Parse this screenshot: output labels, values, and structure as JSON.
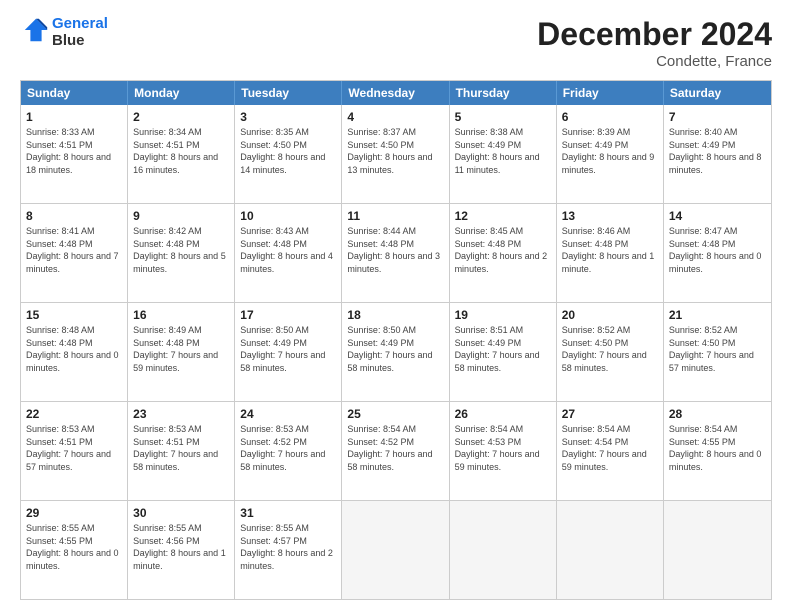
{
  "header": {
    "logo_line1": "General",
    "logo_line2": "Blue",
    "title": "December 2024",
    "subtitle": "Condette, France"
  },
  "days_of_week": [
    "Sunday",
    "Monday",
    "Tuesday",
    "Wednesday",
    "Thursday",
    "Friday",
    "Saturday"
  ],
  "weeks": [
    [
      {
        "day": "1",
        "text": "Sunrise: 8:33 AM\nSunset: 4:51 PM\nDaylight: 8 hours and 18 minutes."
      },
      {
        "day": "2",
        "text": "Sunrise: 8:34 AM\nSunset: 4:51 PM\nDaylight: 8 hours and 16 minutes."
      },
      {
        "day": "3",
        "text": "Sunrise: 8:35 AM\nSunset: 4:50 PM\nDaylight: 8 hours and 14 minutes."
      },
      {
        "day": "4",
        "text": "Sunrise: 8:37 AM\nSunset: 4:50 PM\nDaylight: 8 hours and 13 minutes."
      },
      {
        "day": "5",
        "text": "Sunrise: 8:38 AM\nSunset: 4:49 PM\nDaylight: 8 hours and 11 minutes."
      },
      {
        "day": "6",
        "text": "Sunrise: 8:39 AM\nSunset: 4:49 PM\nDaylight: 8 hours and 9 minutes."
      },
      {
        "day": "7",
        "text": "Sunrise: 8:40 AM\nSunset: 4:49 PM\nDaylight: 8 hours and 8 minutes."
      }
    ],
    [
      {
        "day": "8",
        "text": "Sunrise: 8:41 AM\nSunset: 4:48 PM\nDaylight: 8 hours and 7 minutes."
      },
      {
        "day": "9",
        "text": "Sunrise: 8:42 AM\nSunset: 4:48 PM\nDaylight: 8 hours and 5 minutes."
      },
      {
        "day": "10",
        "text": "Sunrise: 8:43 AM\nSunset: 4:48 PM\nDaylight: 8 hours and 4 minutes."
      },
      {
        "day": "11",
        "text": "Sunrise: 8:44 AM\nSunset: 4:48 PM\nDaylight: 8 hours and 3 minutes."
      },
      {
        "day": "12",
        "text": "Sunrise: 8:45 AM\nSunset: 4:48 PM\nDaylight: 8 hours and 2 minutes."
      },
      {
        "day": "13",
        "text": "Sunrise: 8:46 AM\nSunset: 4:48 PM\nDaylight: 8 hours and 1 minute."
      },
      {
        "day": "14",
        "text": "Sunrise: 8:47 AM\nSunset: 4:48 PM\nDaylight: 8 hours and 0 minutes."
      }
    ],
    [
      {
        "day": "15",
        "text": "Sunrise: 8:48 AM\nSunset: 4:48 PM\nDaylight: 8 hours and 0 minutes."
      },
      {
        "day": "16",
        "text": "Sunrise: 8:49 AM\nSunset: 4:48 PM\nDaylight: 7 hours and 59 minutes."
      },
      {
        "day": "17",
        "text": "Sunrise: 8:50 AM\nSunset: 4:49 PM\nDaylight: 7 hours and 58 minutes."
      },
      {
        "day": "18",
        "text": "Sunrise: 8:50 AM\nSunset: 4:49 PM\nDaylight: 7 hours and 58 minutes."
      },
      {
        "day": "19",
        "text": "Sunrise: 8:51 AM\nSunset: 4:49 PM\nDaylight: 7 hours and 58 minutes."
      },
      {
        "day": "20",
        "text": "Sunrise: 8:52 AM\nSunset: 4:50 PM\nDaylight: 7 hours and 58 minutes."
      },
      {
        "day": "21",
        "text": "Sunrise: 8:52 AM\nSunset: 4:50 PM\nDaylight: 7 hours and 57 minutes."
      }
    ],
    [
      {
        "day": "22",
        "text": "Sunrise: 8:53 AM\nSunset: 4:51 PM\nDaylight: 7 hours and 57 minutes."
      },
      {
        "day": "23",
        "text": "Sunrise: 8:53 AM\nSunset: 4:51 PM\nDaylight: 7 hours and 58 minutes."
      },
      {
        "day": "24",
        "text": "Sunrise: 8:53 AM\nSunset: 4:52 PM\nDaylight: 7 hours and 58 minutes."
      },
      {
        "day": "25",
        "text": "Sunrise: 8:54 AM\nSunset: 4:52 PM\nDaylight: 7 hours and 58 minutes."
      },
      {
        "day": "26",
        "text": "Sunrise: 8:54 AM\nSunset: 4:53 PM\nDaylight: 7 hours and 59 minutes."
      },
      {
        "day": "27",
        "text": "Sunrise: 8:54 AM\nSunset: 4:54 PM\nDaylight: 7 hours and 59 minutes."
      },
      {
        "day": "28",
        "text": "Sunrise: 8:54 AM\nSunset: 4:55 PM\nDaylight: 8 hours and 0 minutes."
      }
    ],
    [
      {
        "day": "29",
        "text": "Sunrise: 8:55 AM\nSunset: 4:55 PM\nDaylight: 8 hours and 0 minutes."
      },
      {
        "day": "30",
        "text": "Sunrise: 8:55 AM\nSunset: 4:56 PM\nDaylight: 8 hours and 1 minute."
      },
      {
        "day": "31",
        "text": "Sunrise: 8:55 AM\nSunset: 4:57 PM\nDaylight: 8 hours and 2 minutes."
      },
      {
        "day": "",
        "text": ""
      },
      {
        "day": "",
        "text": ""
      },
      {
        "day": "",
        "text": ""
      },
      {
        "day": "",
        "text": ""
      }
    ]
  ]
}
